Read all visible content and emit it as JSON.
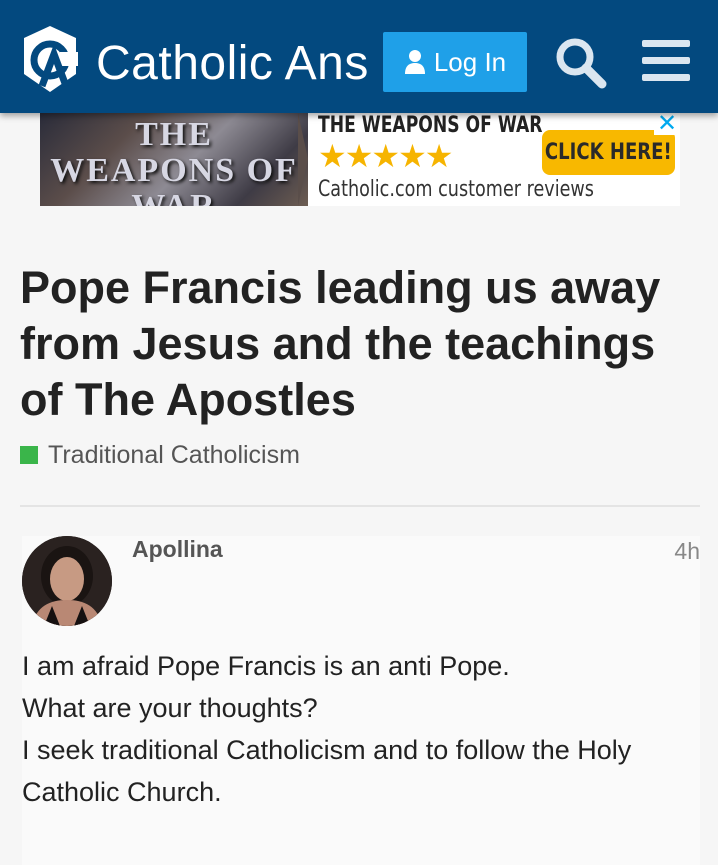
{
  "header": {
    "site_name": "Catholic Answers Forums",
    "login_label": "Log In",
    "search_icon": "search-icon",
    "menu_icon": "hamburger-icon",
    "background_color": "#03497f",
    "login_color": "#1fa0e8"
  },
  "ad": {
    "image_title": "THE WEAPONS OF WAR",
    "headline": "THE WEAPONS OF WAR",
    "stars": "★★★★★",
    "reviews": "Catholic.com customer reviews",
    "cta": "CLICK HERE!",
    "close": "✕"
  },
  "topic": {
    "title": "Pope Francis leading us away from Jesus and the teachings of The Apostles",
    "category": "Traditional Catholicism",
    "category_color": "#3ab54a"
  },
  "post": {
    "username": "Apollina",
    "time": "4h",
    "lines": [
      "I am afraid Pope Francis is an anti Pope.",
      "What are your thoughts?",
      "I seek traditional Catholicism and to follow the Holy Catholic Church."
    ]
  }
}
